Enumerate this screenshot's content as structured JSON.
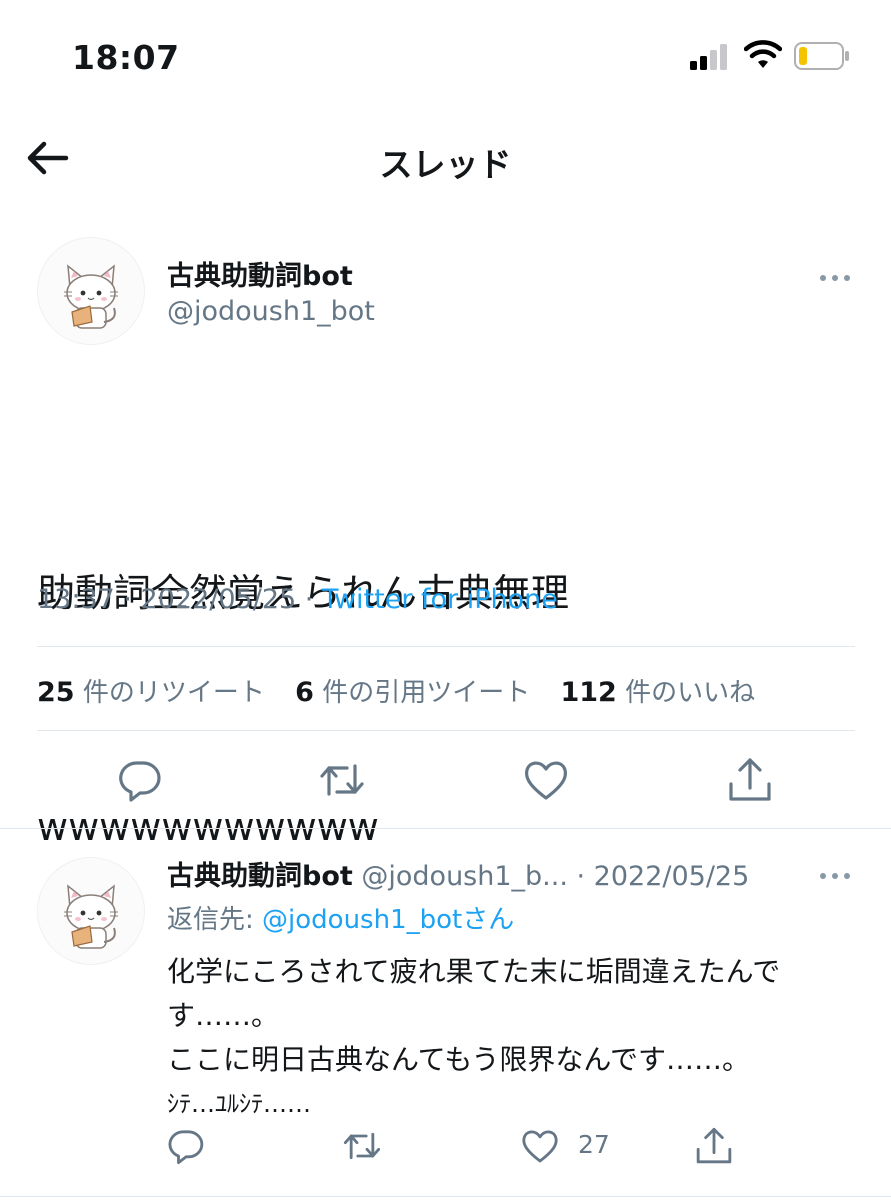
{
  "status_bar": {
    "time": "18:07"
  },
  "nav": {
    "title": "スレッド"
  },
  "tweet": {
    "display_name": "古典助動詞bot",
    "handle": "@jodoush1_bot",
    "text_lines": [
      "助動詞全然覚えられん古典無理",
      "wwwwwwwwwww"
    ],
    "timestamp": "13:37 · 2022/05/25 · ",
    "source": "Twitter for iPhone",
    "stats": {
      "retweets_count": "25",
      "retweets_label": "件のリツイート",
      "quotes_count": "6",
      "quotes_label": "件の引用ツイート",
      "likes_count": "112",
      "likes_label": "件のいいね"
    }
  },
  "reply": {
    "display_name": "古典助動詞bot",
    "handle_date": "@jodoush1_b... · 2022/05/25",
    "reply_to_label": "返信先: ",
    "reply_to_mention": "@jodoush1_botさん",
    "text_lines": [
      "化学にころされて疲れ果てた末に垢間違えたんで",
      "す……。",
      "ここに明日古典なんてもう限界なんです……。",
      "ｼﾃ…ﾕﾙｼﾃ……"
    ],
    "like_count": "27"
  },
  "icons": {
    "back": "arrow-left-icon",
    "more": "more-horizontal-icon",
    "reply": "comment-icon",
    "retweet": "retweet-icon",
    "like": "heart-icon",
    "share": "share-icon"
  },
  "colors": {
    "link": "#1da1f2",
    "secondary": "#657786",
    "text": "#14171a",
    "divider": "#e1e8ed"
  }
}
